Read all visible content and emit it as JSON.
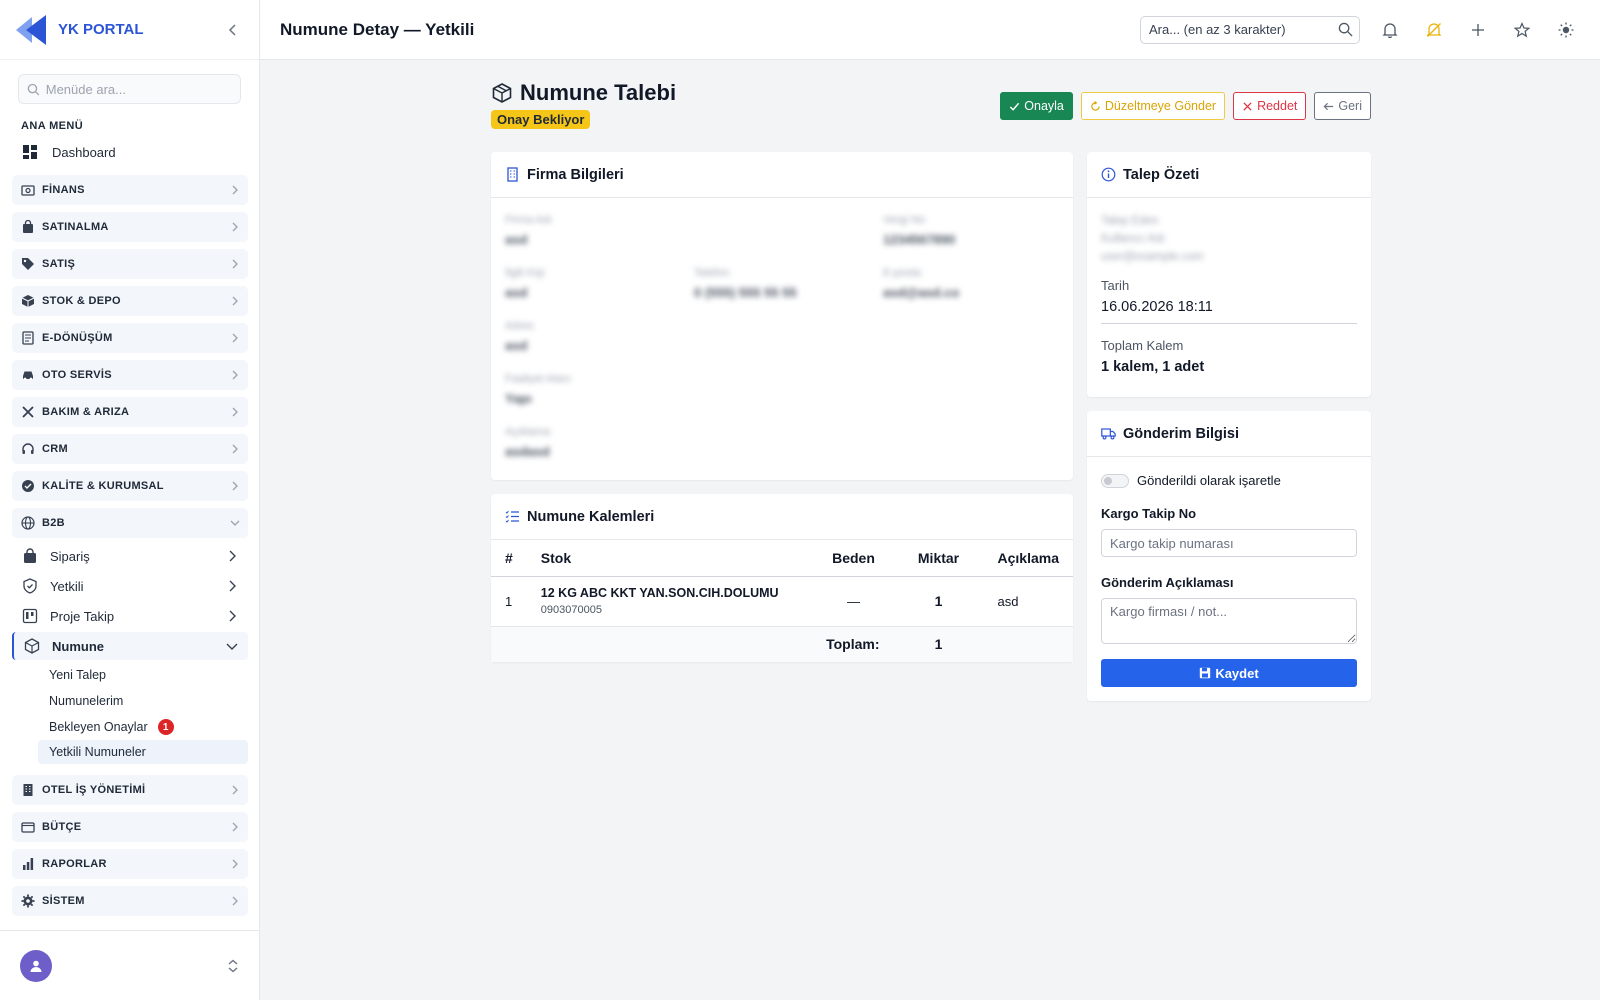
{
  "app": {
    "name": "YK PORTAL",
    "page_title": "Numune Detay — Yetkili"
  },
  "sidebar": {
    "search_placeholder": "Menüde ara...",
    "section_label": "ANA MENÜ",
    "dashboard": "Dashboard",
    "groups_top": [
      {
        "label": "FİNANS",
        "icon": "currency-icon"
      },
      {
        "label": "SATINALMA",
        "icon": "shopping-bag-icon"
      },
      {
        "label": "SATIŞ",
        "icon": "tag-icon"
      },
      {
        "label": "STOK & DEPO",
        "icon": "box-icon"
      },
      {
        "label": "E-DÖNÜŞÜM",
        "icon": "document-icon"
      },
      {
        "label": "OTO SERVİS",
        "icon": "car-icon"
      },
      {
        "label": "BAKIM & ARIZA",
        "icon": "tools-icon"
      },
      {
        "label": "CRM",
        "icon": "headset-icon"
      },
      {
        "label": "KALİTE & KURUMSAL",
        "icon": "badge-check-icon"
      },
      {
        "label": "B2B",
        "icon": "globe-icon"
      }
    ],
    "b2b_subs": [
      {
        "label": "Sipariş"
      },
      {
        "label": "Yetkili"
      },
      {
        "label": "Proje Takip"
      },
      {
        "label": "Numune"
      }
    ],
    "numune_leaves": [
      {
        "label": "Yeni Talep"
      },
      {
        "label": "Numunelerim"
      },
      {
        "label": "Bekleyen Onaylar",
        "badge": "1"
      },
      {
        "label": "Yetkili Numuneler"
      }
    ],
    "groups_bottom": [
      {
        "label": "OTEL İŞ YÖNETİMİ",
        "icon": "building-icon"
      },
      {
        "label": "BÜTÇE",
        "icon": "wallet-icon"
      },
      {
        "label": "RAPORLAR",
        "icon": "bar-chart-icon"
      },
      {
        "label": "SİSTEM",
        "icon": "gear-icon"
      }
    ]
  },
  "topbar": {
    "search_placeholder": "Ara... (en az 3 karakter)"
  },
  "page": {
    "title": "Numune Talebi",
    "status": "Onay Bekliyor",
    "actions": {
      "approve": "Onayla",
      "revise": "Düzeltmeye Gönder",
      "reject": "Reddet",
      "back": "Geri"
    }
  },
  "firma": {
    "header": "Firma Bilgileri",
    "fields": [
      {
        "label": "Firma Adı",
        "value": "asd"
      },
      {
        "label": "Vergi No",
        "value": "1234567890"
      },
      {
        "label": "İlgili Kişi",
        "value": "asd"
      },
      {
        "label": "Telefon",
        "value": "0 (555) 555 55 55"
      },
      {
        "label": "E-posta",
        "value": "asd@asd.co"
      },
      {
        "label": "Adres",
        "value": "asd"
      },
      {
        "label": "Faaliyet Alanı",
        "value": "Yapı"
      },
      {
        "label": "Açıklama",
        "value": "asdasd"
      }
    ]
  },
  "kalemler": {
    "header": "Numune Kalemleri",
    "columns": {
      "no": "#",
      "stock": "Stok",
      "size": "Beden",
      "qty": "Miktar",
      "desc": "Açıklama"
    },
    "rows": [
      {
        "no": "1",
        "name": "12 KG ABC KKT YAN.SON.CIH.DOLUMU",
        "code": "0903070005",
        "size": "—",
        "qty": "1",
        "desc": "asd"
      }
    ],
    "total_label": "Toplam:",
    "total_value": "1"
  },
  "summary": {
    "header": "Talep Özeti",
    "blurred": [
      "Talep Eden",
      "Kullanıcı Adı",
      "user@example.com"
    ],
    "date_label": "Tarih",
    "date_value": "16.06.2026 18:11",
    "items_label": "Toplam Kalem",
    "items_value": "1 kalem, 1 adet"
  },
  "shipping": {
    "header": "Gönderim Bilgisi",
    "toggle_label": "Gönderildi olarak işaretle",
    "tracking_label": "Kargo Takip No",
    "tracking_placeholder": "Kargo takip numarası",
    "note_label": "Gönderim Açıklaması",
    "note_placeholder": "Kargo firması / not...",
    "save": "Kaydet"
  },
  "colors": {
    "brand": "#2c55d6",
    "success": "#198754",
    "warning": "#f0c945",
    "danger": "#dc3545",
    "primary": "#2563eb",
    "badge": "#f5c518"
  }
}
